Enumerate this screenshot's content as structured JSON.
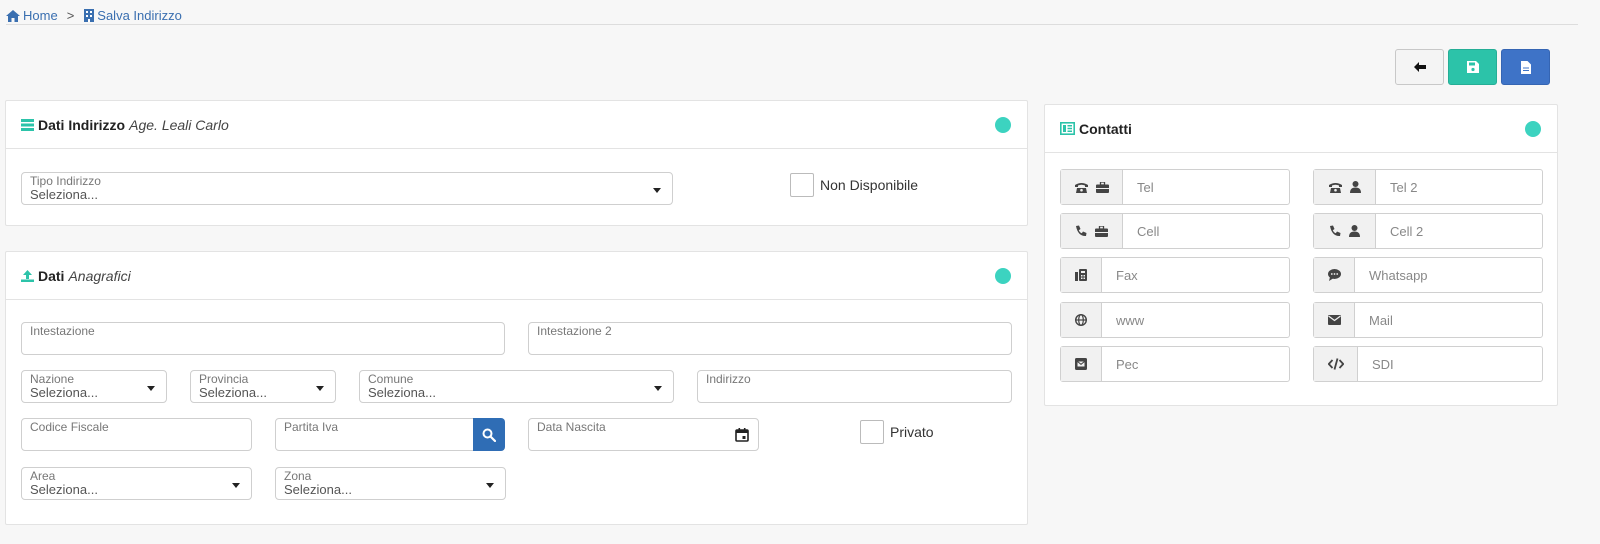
{
  "breadcrumb": {
    "home": "Home",
    "separator": ">",
    "current": "Salva Indirizzo"
  },
  "indirizzo_panel": {
    "title": "Dati Indirizzo",
    "subtitle": "Age. Leali Carlo",
    "tipo_indirizzo": {
      "label": "Tipo Indirizzo",
      "value": "Seleziona..."
    },
    "non_disponibile_label": "Non Disponibile"
  },
  "anagrafici_panel": {
    "title": "Dati",
    "subtitle": "Anagrafici",
    "intestazione": {
      "label": "Intestazione",
      "value": ""
    },
    "intestazione2": {
      "label": "Intestazione 2",
      "value": ""
    },
    "nazione": {
      "label": "Nazione",
      "value": "Seleziona..."
    },
    "provincia": {
      "label": "Provincia",
      "value": "Seleziona..."
    },
    "comune": {
      "label": "Comune",
      "value": "Seleziona..."
    },
    "indirizzo": {
      "label": "Indirizzo",
      "value": ""
    },
    "codice_fiscale": {
      "label": "Codice Fiscale",
      "value": ""
    },
    "partita_iva": {
      "label": "Partita Iva",
      "value": ""
    },
    "data_nascita": {
      "label": "Data Nascita",
      "value": ""
    },
    "privato_label": "Privato",
    "area": {
      "label": "Area",
      "value": "Seleziona..."
    },
    "zona": {
      "label": "Zona",
      "value": "Seleziona..."
    }
  },
  "contatti_panel": {
    "title": "Contatti",
    "fields": {
      "tel": "Tel",
      "tel2": "Tel 2",
      "cell": "Cell",
      "cell2": "Cell 2",
      "fax": "Fax",
      "whatsapp": "Whatsapp",
      "www": "www",
      "mail": "Mail",
      "pec": "Pec",
      "sdi": "SDI"
    }
  },
  "colors": {
    "accent_teal": "#2cc3a9",
    "accent_blue": "#3e73c7",
    "status_dot": "#3cd3c0",
    "link": "#3a6fb0"
  }
}
